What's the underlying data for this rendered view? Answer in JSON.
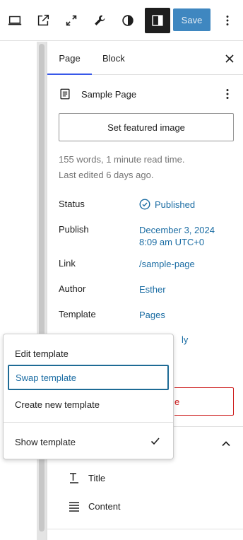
{
  "toolbar": {
    "save_label": "Save",
    "icons": [
      "desktop-preview-icon",
      "external-link-icon",
      "fullscreen-icon",
      "wrench-icon",
      "contrast-icon",
      "sidebar-toggle-icon",
      "more-vertical-icon"
    ]
  },
  "sidebar": {
    "tabs": [
      {
        "label": "Page"
      },
      {
        "label": "Block"
      }
    ],
    "document": {
      "title": "Sample Page"
    },
    "featured_image_label": "Set featured image",
    "meta": {
      "words": "155 words, 1 minute read time.",
      "edited": "Last edited 6 days ago."
    },
    "properties": {
      "status": {
        "label": "Status",
        "value": "Published"
      },
      "publish": {
        "label": "Publish",
        "value_line1": "December 3, 2024",
        "value_line2": "8:09 am UTC+0"
      },
      "link": {
        "label": "Link",
        "value": "/sample-page"
      },
      "author": {
        "label": "Author",
        "value": "Esther"
      },
      "template": {
        "label": "Template",
        "value": "Pages"
      }
    },
    "obscured_fragment": "ly",
    "obscured_button_fragment": "e",
    "outline": [
      {
        "label": "Title"
      },
      {
        "label": "Content"
      }
    ]
  },
  "popover": {
    "items": [
      {
        "label": "Edit template"
      },
      {
        "label": "Swap template"
      },
      {
        "label": "Create new template"
      }
    ],
    "toggle": {
      "label": "Show template",
      "checked": true
    }
  },
  "colors": {
    "accent": "#3858e9",
    "link": "#1a6ca3",
    "save_bg": "#3f87c0",
    "danger": "#cc1818"
  }
}
